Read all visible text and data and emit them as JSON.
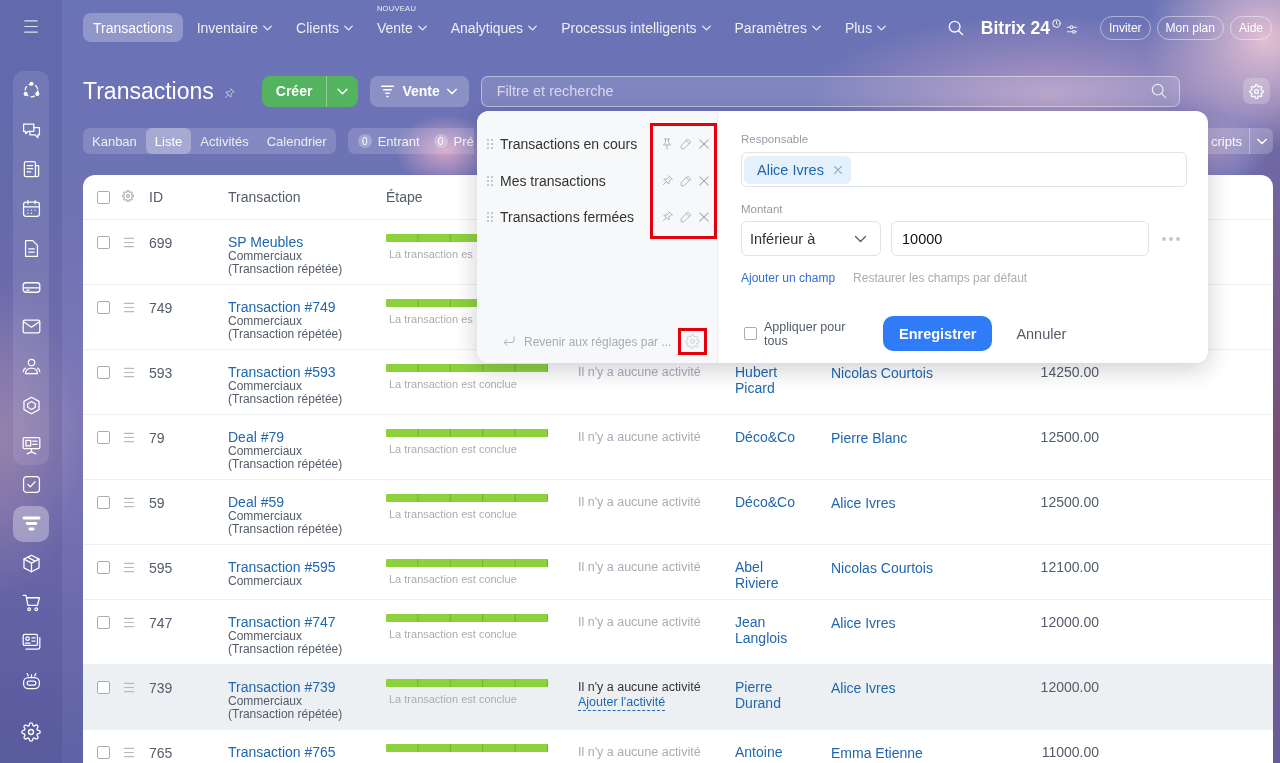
{
  "sidebar": {
    "group": [
      {
        "selected": false
      },
      {
        "selected": false
      },
      {
        "selected": false
      },
      {
        "selected": false
      },
      {
        "selected": false
      },
      {
        "selected": false
      },
      {
        "selected": false
      },
      {
        "selected": false
      },
      {
        "selected": false
      },
      {
        "selected": false
      }
    ],
    "items": [
      {
        "selected": false
      },
      {
        "selected": true
      },
      {
        "selected": false
      },
      {
        "selected": false
      },
      {
        "selected": false
      },
      {
        "selected": false
      }
    ]
  },
  "top_nav": {
    "items": [
      {
        "label": "Transactions",
        "selected": true,
        "has_menu": false
      },
      {
        "label": "Inventaire",
        "selected": false,
        "has_menu": true
      },
      {
        "label": "Clients",
        "selected": false,
        "has_menu": true
      },
      {
        "label": "Vente",
        "selected": false,
        "has_menu": true,
        "badge": "NOUVEAU"
      },
      {
        "label": "Analytiques",
        "selected": false,
        "has_menu": true
      },
      {
        "label": "Processus intelligents",
        "selected": false,
        "has_menu": true
      },
      {
        "label": "Paramètres",
        "selected": false,
        "has_menu": true
      },
      {
        "label": "Plus",
        "selected": false,
        "has_menu": true
      }
    ],
    "logo": "Bitrix 24",
    "buttons": [
      "Inviter",
      "Mon plan",
      "Aide"
    ]
  },
  "header": {
    "title": "Transactions",
    "create_button": "Créer",
    "category_button": "Vente",
    "search": {
      "placeholder": "Filtre et recherche"
    }
  },
  "view_tabs": [
    {
      "label": "Kanban",
      "selected": false
    },
    {
      "label": "Liste",
      "selected": true
    },
    {
      "label": "Activités",
      "selected": false
    },
    {
      "label": "Calendrier",
      "selected": false
    }
  ],
  "counters": [
    {
      "count": "0",
      "label": "Entrant"
    },
    {
      "count": "0",
      "label": "Pré"
    }
  ],
  "toolbar_button": {
    "label": "cripts"
  },
  "table": {
    "all_checked": false,
    "columns": [
      "ID",
      "Transaction",
      "Étape"
    ],
    "rows": [
      {
        "checked": false,
        "highlighted": false,
        "id": "699",
        "title": "SP Meubles",
        "lines": [
          "Commerciaux",
          "(Transaction répétée)"
        ],
        "level": 1,
        "stage": "La transaction es"
      },
      {
        "checked": false,
        "highlighted": false,
        "id": "749",
        "title": "Transaction #749",
        "lines": [
          "Commerciaux",
          "(Transaction répétée)"
        ],
        "level": 1,
        "stage": "La transaction es"
      },
      {
        "checked": false,
        "highlighted": false,
        "id": "593",
        "title": "Transaction #593",
        "lines": [
          "Commerciaux",
          "(Transaction répétée)"
        ],
        "level": 1,
        "stage": "La transaction est conclue",
        "activity": "Il n'y a aucune activité",
        "client": "Hubert Picard",
        "responsible": "Nicolas Courtois",
        "amount": "14250.00"
      },
      {
        "checked": false,
        "highlighted": false,
        "id": "79",
        "title": "Deal #79",
        "lines": [
          "Commerciaux",
          "(Transaction répétée)"
        ],
        "level": 1,
        "stage": "La transaction est conclue",
        "activity": "Il n'y a aucune activité",
        "client": "Déco&Co",
        "responsible": "Pierre Blanc",
        "amount": "12500.00"
      },
      {
        "checked": false,
        "highlighted": false,
        "id": "59",
        "title": "Deal #59",
        "lines": [
          "Commerciaux",
          "(Transaction répétée)"
        ],
        "level": 1,
        "stage": "La transaction est conclue",
        "activity": "Il n'y a aucune activité",
        "client": "Déco&Co",
        "responsible": "Alice Ivres",
        "amount": "12500.00"
      },
      {
        "checked": false,
        "highlighted": false,
        "id": "595",
        "title": "Transaction #595",
        "lines": [
          "Commerciaux"
        ],
        "level": 1,
        "stage": "La transaction est conclue",
        "activity": "Il n'y a aucune activité",
        "client": "Abel Riviere",
        "responsible": "Nicolas Courtois",
        "amount": "12100.00"
      },
      {
        "checked": false,
        "highlighted": false,
        "id": "747",
        "title": "Transaction #747",
        "lines": [
          "Commerciaux",
          "(Transaction répétée)"
        ],
        "level": 1,
        "stage": "La transaction est conclue",
        "activity": "Il n'y a aucune activité",
        "client": "Jean Langlois",
        "responsible": "Alice Ivres",
        "amount": "12000.00"
      },
      {
        "checked": false,
        "highlighted": true,
        "id": "739",
        "title": "Transaction #739",
        "lines": [
          "Commerciaux",
          "(Transaction répétée)"
        ],
        "level": 1,
        "stage": "La transaction est conclue",
        "activity": "Il n'y a aucune activité",
        "activity_link": "Ajouter l'activité",
        "client": "Pierre Durand",
        "responsible": "Alice Ivres",
        "amount": "12000.00"
      },
      {
        "checked": false,
        "highlighted": false,
        "id": "765",
        "title": "Transaction #765",
        "level": 1,
        "activity": "Il n'y a aucune activité",
        "client": "Antoine",
        "responsible": "Emma Etienne",
        "amount": "11000.00"
      }
    ]
  },
  "filter_popup": {
    "presets": [
      {
        "label": "Transactions en cours",
        "pinned": true
      },
      {
        "label": "Mes transactions",
        "pinned": false
      },
      {
        "label": "Transactions fermées",
        "pinned": false
      }
    ],
    "actions_marked": true,
    "reset": {
      "label": "Revenir aux réglages par ...",
      "gear_marked": true
    },
    "fields": [
      {
        "kind": "tags",
        "label": "Responsable",
        "tags": [
          "Alice Ivres"
        ]
      },
      {
        "kind": "range",
        "label": "Montant",
        "operator": "Inférieur à",
        "value": "10000"
      }
    ],
    "links": {
      "add": "Ajouter un champ",
      "restore": "Restaurer les champs par défaut"
    },
    "apply_all": {
      "label": "Appliquer pour tous",
      "checked": false
    },
    "save_button": "Enregistrer",
    "cancel_button": "Annuler"
  }
}
